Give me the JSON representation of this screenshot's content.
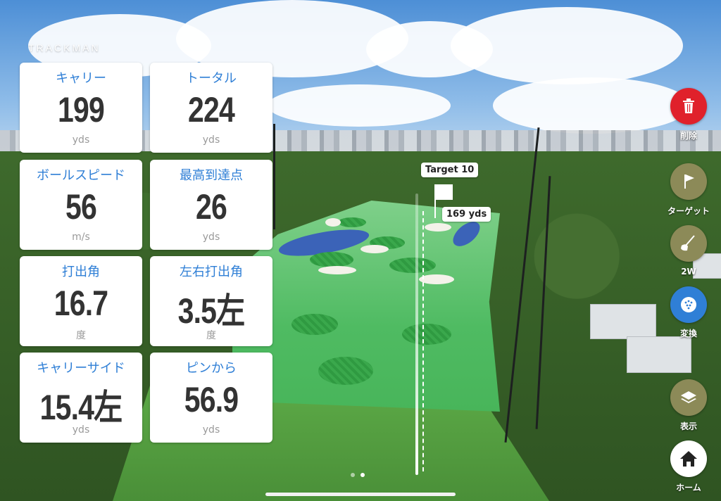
{
  "brand": "TRACKMAN",
  "cards": [
    {
      "label": "キャリー",
      "value": "199",
      "unit": "yds"
    },
    {
      "label": "トータル",
      "value": "224",
      "unit": "yds"
    },
    {
      "label": "ボールスピード",
      "value": "56",
      "unit": "m/s"
    },
    {
      "label": "最高到達点",
      "value": "26",
      "unit": "yds"
    },
    {
      "label": "打出角",
      "value": "16.7",
      "unit": "度"
    },
    {
      "label": "左右打出角",
      "value": "3.5左",
      "unit": "度"
    },
    {
      "label": "キャリーサイド",
      "value": "15.4左",
      "unit": "yds"
    },
    {
      "label": "ピンから",
      "value": "56.9",
      "unit": "yds"
    }
  ],
  "target": {
    "name": "Target 10",
    "distance": "169 yds"
  },
  "side_buttons": [
    {
      "label": "削除",
      "icon": "trash-icon",
      "color": "#e0212b"
    },
    {
      "label": "ターゲット",
      "icon": "flag-icon",
      "color": "#8c8a58"
    },
    {
      "label": "2W",
      "icon": "club-icon",
      "color": "#8c8a58"
    },
    {
      "label": "変換",
      "icon": "ball-icon",
      "color": "#2f7fd6"
    },
    {
      "label": "表示",
      "icon": "layers-icon",
      "color": "#8c8a58"
    },
    {
      "label": "ホーム",
      "icon": "home-icon",
      "color": "#ffffff"
    }
  ],
  "pager": {
    "pages": 2,
    "current": 2
  }
}
